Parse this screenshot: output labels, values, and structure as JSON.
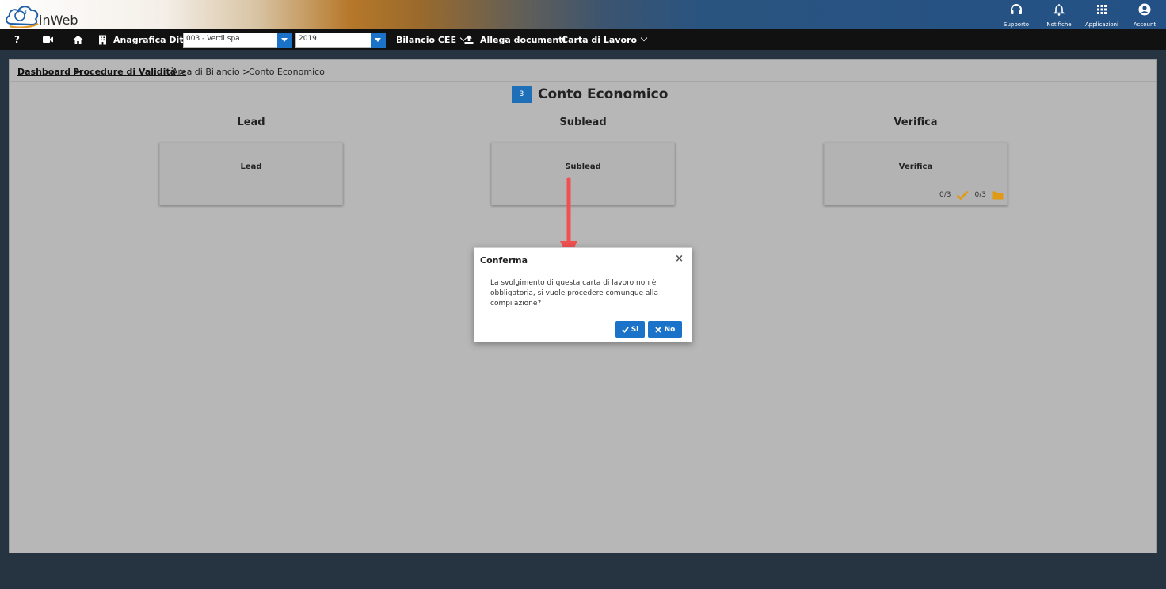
{
  "header": {
    "logo_text": "inWeb",
    "logo_mark": "G3",
    "icons": [
      {
        "name": "headset-icon",
        "label": "Supporto"
      },
      {
        "name": "bell-icon",
        "label": "Notifiche"
      },
      {
        "name": "grid-icon",
        "label": "Applicazioni"
      },
      {
        "name": "account-icon",
        "label": "Account"
      }
    ]
  },
  "nav": {
    "help": "?",
    "company_label": "Anagrafica Ditte",
    "company_value": "003 - Verdi spa",
    "year_value": "2019",
    "bilancio": "Bilancio CEE",
    "allega": "Allega documenti",
    "carta": "Carta di Lavoro"
  },
  "breadcrumb": {
    "items": [
      "Dashboard",
      "Procedure di Validità",
      "Area di Bilancio",
      "Conto Economico"
    ],
    "separator": ">"
  },
  "page": {
    "step": "3",
    "title": "Conto Economico"
  },
  "columns": [
    {
      "heading": "Lead",
      "card_label": "Lead"
    },
    {
      "heading": "Sublead",
      "card_label": "Sublead"
    },
    {
      "heading": "Verifica",
      "card_label": "Verifica",
      "check_count": "0/3",
      "doc_count": "0/3"
    }
  ],
  "modal": {
    "title": "Conferma",
    "close": "×",
    "message": "La svolgimento di questa carta di lavoro non è obbligatoria, si vuole procedere comunque alla compilazione?",
    "yes_label": "Si",
    "no_label": "No"
  },
  "colors": {
    "accent": "#1a73c8",
    "annotation": "#f05050",
    "warning": "#e09a16"
  }
}
